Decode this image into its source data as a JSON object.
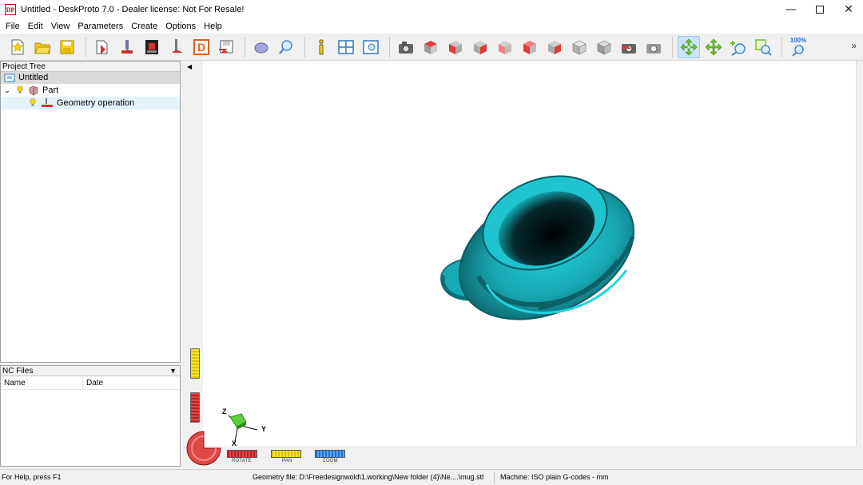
{
  "window": {
    "title": "Untitled - DeskProto 7.0 - Dealer license: Not For Resale!",
    "app_icon_text": "DP"
  },
  "menu": [
    "File",
    "Edit",
    "View",
    "Parameters",
    "Create",
    "Options",
    "Help"
  ],
  "toolbar": {
    "zoom_label": "100%",
    "buttons": [
      "new-project",
      "open-project",
      "save-project",
      "part-parameters",
      "operation-parameters",
      "machine-parameters",
      "cutter-parameters",
      "drawing-parameters",
      "save-nc",
      "geometry-view",
      "geometry-zoom",
      "info",
      "tile-views",
      "view-layout",
      "camera-view",
      "view-top",
      "view-front",
      "view-right",
      "view-left",
      "view-back",
      "view-bottom",
      "view-iso",
      "view-iso-2",
      "view-undo",
      "view-redo",
      "rotate-mode",
      "pan-mode",
      "zoom-mode",
      "zoom-window",
      "zoom-fit"
    ]
  },
  "project_tree": {
    "title": "Project Tree",
    "root": "Untitled",
    "items": [
      {
        "label": "Part",
        "level": 1
      },
      {
        "label": "Geometry operation",
        "level": 2,
        "selected": true
      }
    ]
  },
  "nc_files": {
    "title": "NC Files",
    "columns": [
      "Name",
      "Date"
    ]
  },
  "viewport": {
    "model_color": "#1fb5c0",
    "axes": {
      "x": "X",
      "y": "Y",
      "z": "Z"
    },
    "sliders": {
      "rotate": "ROTATE",
      "pan": "PAN",
      "zoom": "ZOOM"
    }
  },
  "statusbar": {
    "help": "For Help, press F1",
    "geometry_file": "Geometry file: D:\\Freedesignwold\\1.working\\New folder (4)\\Ne....\\mug.stl",
    "machine": "Machine: ISO plain G-codes - mm"
  }
}
